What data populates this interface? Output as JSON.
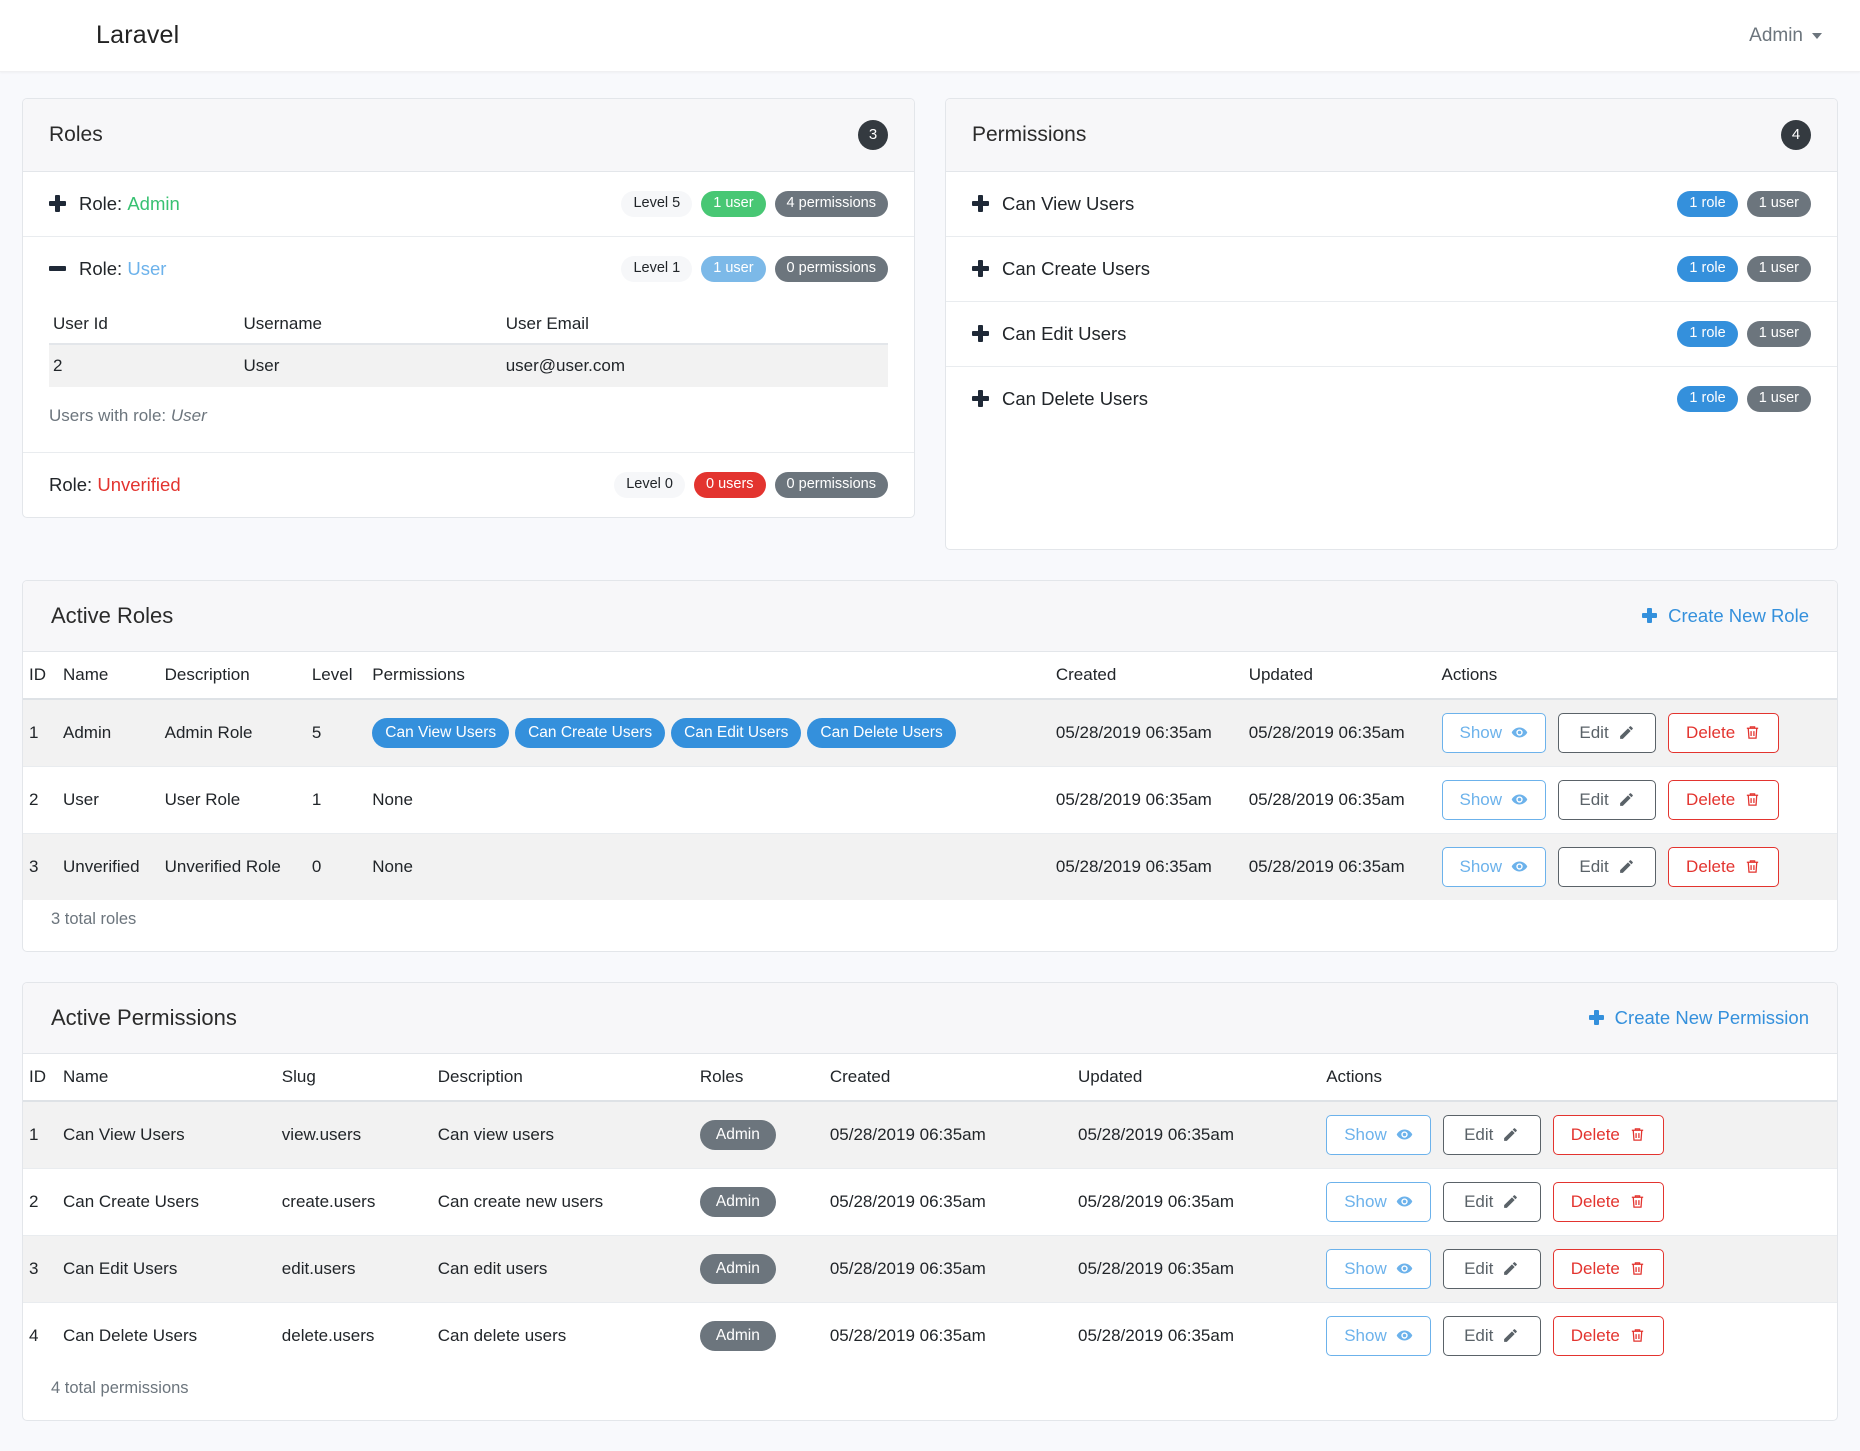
{
  "navbar": {
    "brand": "Laravel",
    "user_menu": "Admin"
  },
  "roles_card": {
    "title": "Roles",
    "count": "3",
    "items": [
      {
        "toggle_icon": "plus-icon",
        "prefix": "Role:",
        "name": "Admin",
        "level": "Level 5",
        "users_badge": "1 user",
        "permissions_badge": "4 permissions",
        "expanded": false
      },
      {
        "toggle_icon": "minus-icon",
        "prefix": "Role:",
        "name": "User",
        "level": "Level 1",
        "users_badge": "1 user",
        "permissions_badge": "0 permissions",
        "expanded": true,
        "table": {
          "headers": [
            "User Id",
            "Username",
            "User Email"
          ],
          "rows": [
            [
              "2",
              "User",
              "user@user.com"
            ]
          ]
        },
        "caption_prefix": "Users with role:",
        "caption_value": "User"
      },
      {
        "toggle_icon": "none",
        "prefix": "Role:",
        "name": "Unverified",
        "level": "Level 0",
        "users_badge": "0 users",
        "permissions_badge": "0 permissions",
        "expanded": false
      }
    ]
  },
  "permissions_card": {
    "title": "Permissions",
    "count": "4",
    "items": [
      {
        "toggle_icon": "plus-icon",
        "name": "Can View Users",
        "roles_badge": "1 role",
        "users_badge": "1 user"
      },
      {
        "toggle_icon": "plus-icon",
        "name": "Can Create Users",
        "roles_badge": "1 role",
        "users_badge": "1 user"
      },
      {
        "toggle_icon": "plus-icon",
        "name": "Can Edit Users",
        "roles_badge": "1 role",
        "users_badge": "1 user"
      },
      {
        "toggle_icon": "plus-icon",
        "name": "Can Delete Users",
        "roles_badge": "1 role",
        "users_badge": "1 user"
      }
    ]
  },
  "active_roles": {
    "title": "Active Roles",
    "create_label": "Create New Role",
    "headers": [
      "ID",
      "Name",
      "Description",
      "Level",
      "Permissions",
      "Created",
      "Updated",
      "Actions"
    ],
    "rows": [
      {
        "id": "1",
        "name": "Admin",
        "description": "Admin Role",
        "level": "5",
        "permissions": [
          "Can View Users",
          "Can Create Users",
          "Can Edit Users",
          "Can Delete Users"
        ],
        "permissions_none": "",
        "created": "05/28/2019 06:35am",
        "updated": "05/28/2019 06:35am"
      },
      {
        "id": "2",
        "name": "User",
        "description": "User Role",
        "level": "1",
        "permissions": [],
        "permissions_none": "None",
        "created": "05/28/2019 06:35am",
        "updated": "05/28/2019 06:35am"
      },
      {
        "id": "3",
        "name": "Unverified",
        "description": "Unverified Role",
        "level": "0",
        "permissions": [],
        "permissions_none": "None",
        "created": "05/28/2019 06:35am",
        "updated": "05/28/2019 06:35am"
      }
    ],
    "footer": "3 total roles"
  },
  "active_permissions": {
    "title": "Active Permissions",
    "create_label": "Create New Permission",
    "headers": [
      "ID",
      "Name",
      "Slug",
      "Description",
      "Roles",
      "Created",
      "Updated",
      "Actions"
    ],
    "rows": [
      {
        "id": "1",
        "name": "Can View Users",
        "slug": "view.users",
        "description": "Can view users",
        "roles": [
          "Admin"
        ],
        "created": "05/28/2019 06:35am",
        "updated": "05/28/2019 06:35am"
      },
      {
        "id": "2",
        "name": "Can Create Users",
        "slug": "create.users",
        "description": "Can create new users",
        "roles": [
          "Admin"
        ],
        "created": "05/28/2019 06:35am",
        "updated": "05/28/2019 06:35am"
      },
      {
        "id": "3",
        "name": "Can Edit Users",
        "slug": "edit.users",
        "description": "Can edit users",
        "roles": [
          "Admin"
        ],
        "created": "05/28/2019 06:35am",
        "updated": "05/28/2019 06:35am"
      },
      {
        "id": "4",
        "name": "Can Delete Users",
        "slug": "delete.users",
        "description": "Can delete users",
        "roles": [
          "Admin"
        ],
        "created": "05/28/2019 06:35am",
        "updated": "05/28/2019 06:35am"
      }
    ],
    "footer": "4 total permissions"
  },
  "buttons": {
    "show": "Show",
    "edit": "Edit",
    "delete": "Delete"
  },
  "colors": {
    "primary": "#3490dc",
    "info": "#6cb2eb",
    "success": "#38c172",
    "danger": "#e3342f",
    "secondary": "#6c757d",
    "dark": "#343a40",
    "page_bg": "#f8f9fc"
  }
}
